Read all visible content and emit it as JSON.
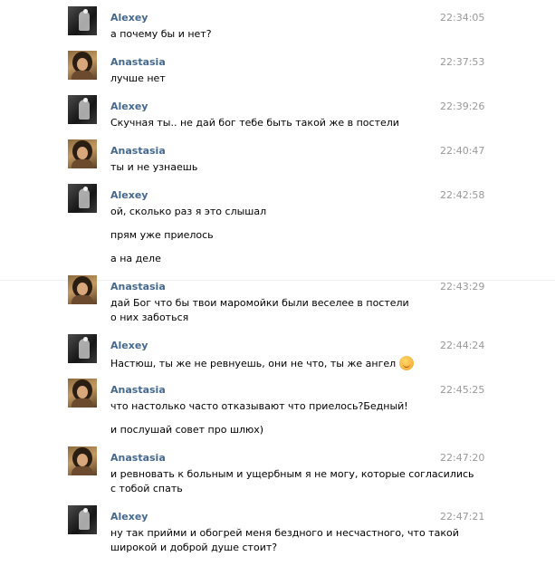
{
  "messages": [
    {
      "author": "Alexey",
      "time": "22:34:05",
      "avatar": "alexey",
      "lines": [
        "а почему бы и нет?"
      ]
    },
    {
      "author": "Anastasia",
      "time": "22:37:53",
      "avatar": "anastasia",
      "lines": [
        "лучше нет"
      ]
    },
    {
      "author": "Alexey",
      "time": "22:39:26",
      "avatar": "alexey",
      "lines": [
        "Скучная ты.. не дай бог тебе быть такой же в постели"
      ]
    },
    {
      "author": "Anastasia",
      "time": "22:40:47",
      "avatar": "anastasia",
      "lines": [
        "ты и не узнаешь"
      ]
    },
    {
      "author": "Alexey",
      "time": "22:42:58",
      "avatar": "alexey",
      "lines": [
        "ой, сколько раз я это слышал",
        "прям уже приелось",
        "а на деле"
      ]
    },
    {
      "author": "Anastasia",
      "time": "22:43:29",
      "avatar": "anastasia",
      "lines": [
        "дай Бог что бы твои маромойки были веселее в постели",
        "о них заботься"
      ]
    },
    {
      "author": "Alexey",
      "time": "22:44:24",
      "avatar": "alexey",
      "lines": [
        "Настюш, ты же не ревнуешь, они не что, ты же ангел"
      ],
      "emoji": "blushing-smile-emoji"
    },
    {
      "author": "Anastasia",
      "time": "22:45:25",
      "avatar": "anastasia",
      "lines": [
        "что настолько часто отказывают что приелось?Бедный!",
        "и послушай совет про шлюх)"
      ]
    },
    {
      "author": "Anastasia",
      "time": "22:47:20",
      "avatar": "anastasia",
      "lines": [
        "и ревновать к больным и ущербным я не могу, которые согласились",
        "с тобой спать"
      ]
    },
    {
      "author": "Alexey",
      "time": "22:47:21",
      "avatar": "alexey",
      "lines": [
        "ну так прийми и обогрей меня бездного и несчастного, что такой",
        "широкой и доброй душе стоит?"
      ]
    }
  ]
}
